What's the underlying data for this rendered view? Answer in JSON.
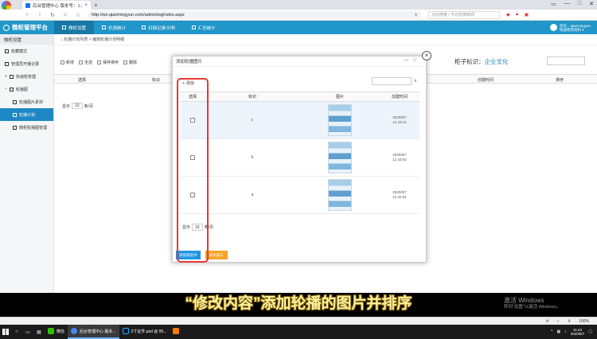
{
  "browser": {
    "tab_title": "后台管理中心 版本号：1.2.0",
    "tab_close": "×",
    "new_tab": "+",
    "window_controls": [
      "▭",
      "—",
      "□",
      "✕"
    ],
    "url": "http://wx.qianmingyun.com/admin/wgIndex.aspx",
    "search_placeholder": "点此搜索 | 今日热搜新闻",
    "nav_icons": [
      "‹",
      "›",
      "↻",
      "⌂",
      "☆"
    ]
  },
  "app": {
    "brand": "微柜管理平台",
    "nav": [
      {
        "label": "微柜设置"
      },
      {
        "label": "抗测统计"
      },
      {
        "label": "扫描记录/分析"
      },
      {
        "label": "汇总统计"
      }
    ],
    "user_line1": "您好，qianmingyun",
    "user_line2": "快速修改资料 ▾"
  },
  "sidebar": {
    "header": "微柜设置",
    "items": [
      {
        "label": "收藏模式"
      },
      {
        "label": "管理员开播记录"
      },
      {
        "label": "快递柜管理"
      },
      {
        "label": "轮播图"
      },
      {
        "label": "轮播图片素材"
      },
      {
        "label": "轮播计划"
      },
      {
        "label": "微柜轮播图管理"
      }
    ]
  },
  "main": {
    "breadcrumb": "⌂ 轮播计划列表 > 编辑轮播计划明细",
    "toolbar": [
      "新增",
      "全选",
      "保存排序",
      "删除"
    ],
    "title_label": "柜子标识：",
    "title_value": "企业文化",
    "columns": [
      "选择",
      "标识",
      "创建时间",
      "排序"
    ],
    "pager_show": "显示",
    "pager_size": "10",
    "pager_unit": "条/页"
  },
  "modal": {
    "title": "添加轮播图片",
    "add_label": "添加",
    "close_glyph": "×",
    "min_glyph": "—",
    "max_glyph": "□",
    "columns": [
      "选择",
      "标识",
      "图片",
      "创建时间"
    ],
    "rows": [
      {
        "id": "c",
        "date": "2020/8/7",
        "time": "11:43:12"
      },
      {
        "id": "b",
        "date": "2020/8/7",
        "time": "11:43:03"
      },
      {
        "id": "a",
        "date": "2020/8/7",
        "time": "11:42:54"
      }
    ],
    "pager_show": "显示",
    "pager_size": "10",
    "pager_unit": "条/页",
    "confirm_button": "添加到选中",
    "close_button": "关闭窗口"
  },
  "overlay_text": {
    "subtitle": "“修改内容”添加轮播的图片并排序",
    "activate_title": "激活 Windows",
    "activate_sub": "转到“设置”以激活 Windows。"
  },
  "statusbar": {
    "zoom": "100%"
  },
  "taskbar": {
    "apps": [
      {
        "label": "微信",
        "color": "#2dc100"
      },
      {
        "label": "后台管理中心 版本...",
        "color": "#4285f4"
      },
      {
        "label": "2寸证件.psd @ 95...",
        "color": "#001d34"
      },
      {
        "label": "",
        "color": "#ff7c00"
      }
    ],
    "time": "11:43",
    "date": "2020/8/7"
  }
}
